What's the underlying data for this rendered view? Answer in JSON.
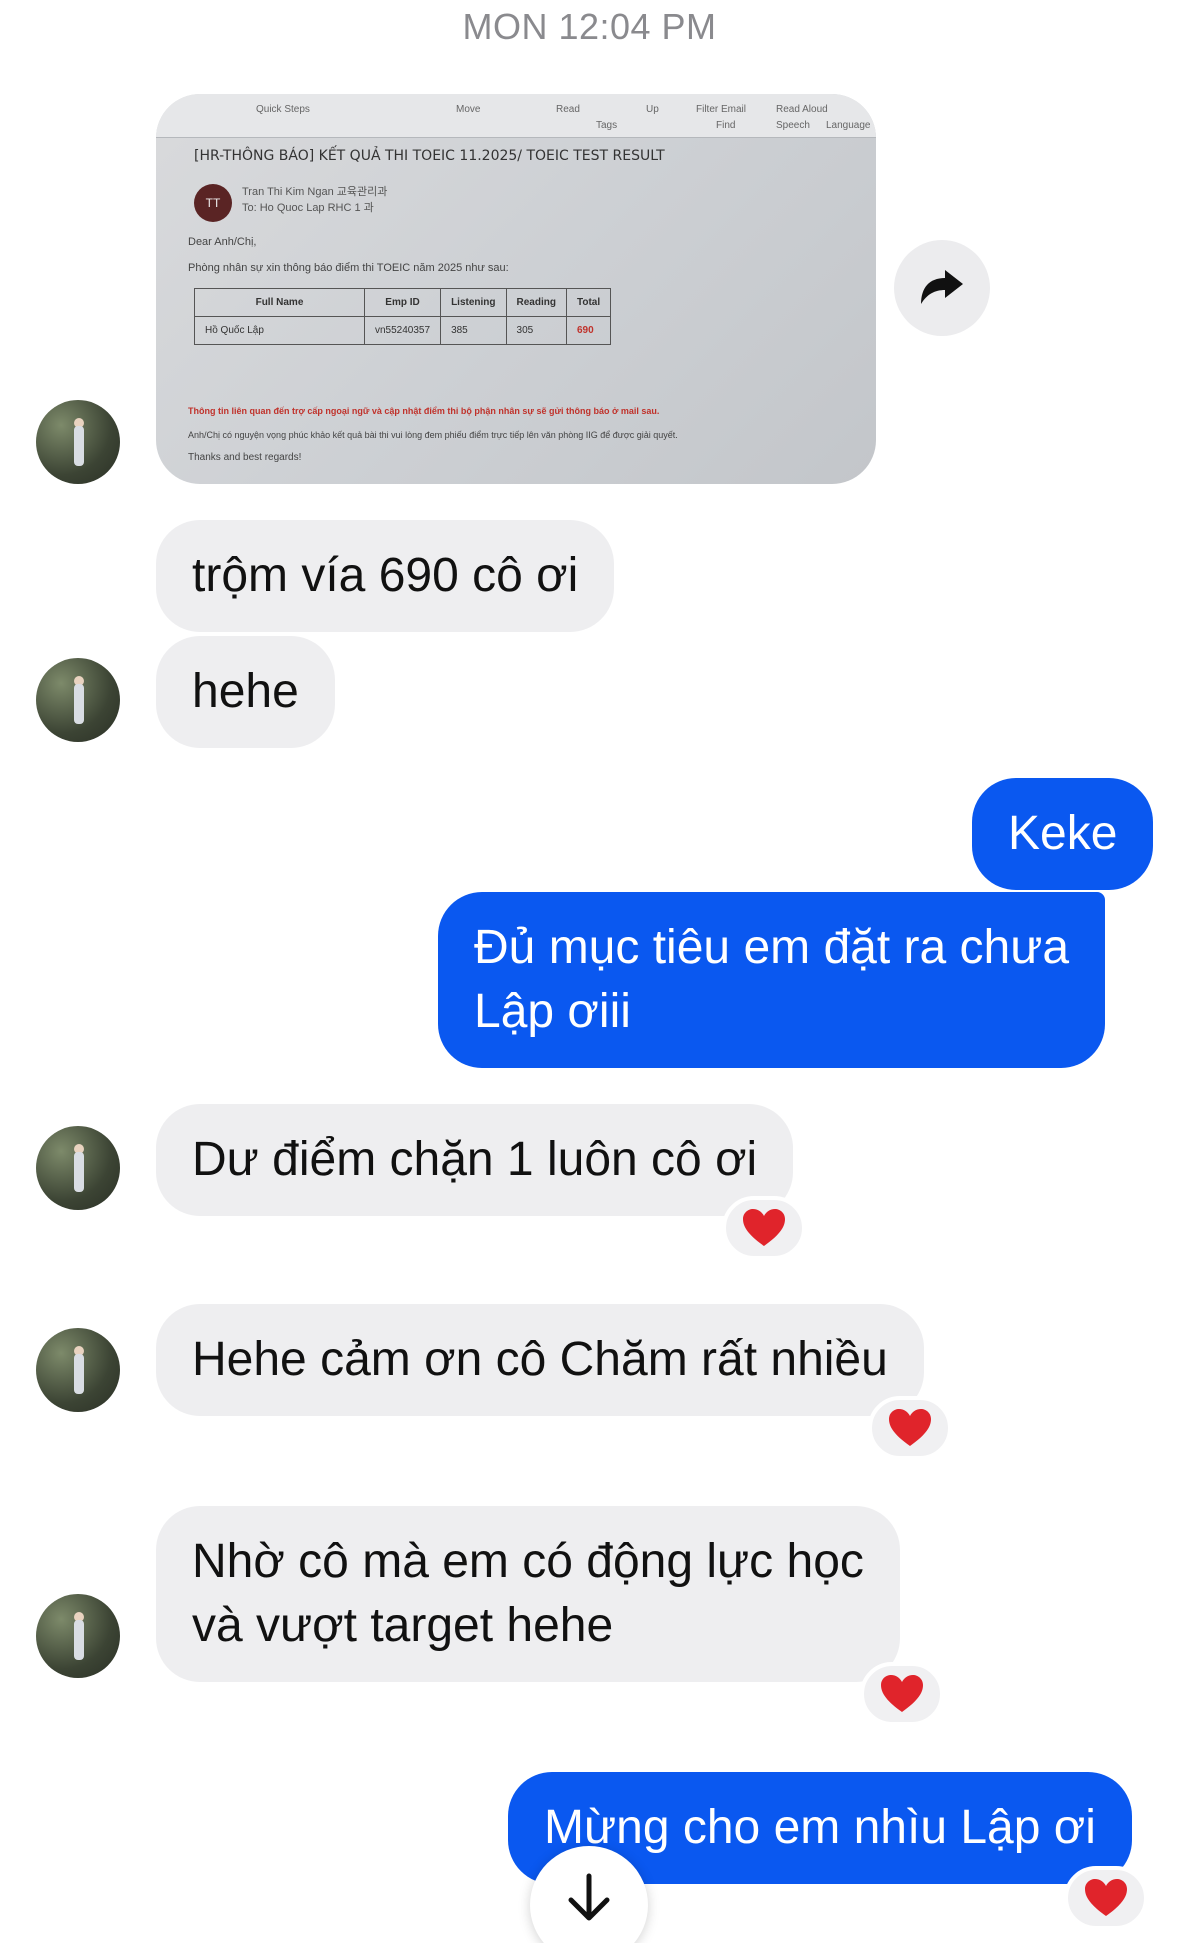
{
  "header": {
    "timestamp": "MON 12:04 PM"
  },
  "photo": {
    "ribbon": [
      "Quick Steps",
      "Move",
      "Read",
      "Tags",
      "Up",
      "Filter Email",
      "Find",
      "Read Aloud",
      "Speech",
      "Language"
    ],
    "subject": "[HR-THÔNG BÁO] KẾT QUẢ THI TOEIC 11.2025/ TOEIC TEST RESULT",
    "avatar_initials": "TT",
    "from": "Tran Thi Kim Ngan 교육관리과",
    "to": "To: Ho Quoc Lap RHC 1 과",
    "greeting": "Dear Anh/Chị,",
    "intro": "Phòng nhân sự xin thông báo điểm thi TOEIC năm 2025 như sau:",
    "table": {
      "headers": [
        "Full Name",
        "Emp ID",
        "Listening",
        "Reading",
        "Total"
      ],
      "row": [
        "Hồ Quốc Lập",
        "vn55240357",
        "385",
        "305",
        "690"
      ]
    },
    "note_red": "Thông tin liên quan đến trợ cấp ngoại ngữ và cập nhật điểm thi bộ phận nhân sự sẽ gửi thông báo ở mail sau.",
    "note": "Anh/Chị có nguyện vọng phúc khảo kết quả bài thi vui lòng đem phiếu điểm trực tiếp lên văn phòng IIG để được giải quyết.",
    "closing": "Thanks and best regards!"
  },
  "messages": [
    {
      "side": "in",
      "text": "trộm vía 690 cô ơi"
    },
    {
      "side": "in",
      "text": "hehe"
    },
    {
      "side": "out",
      "text": "Keke"
    },
    {
      "side": "out",
      "text": "Đủ mục tiêu em đặt ra chưa",
      "text2": "Lập ơiii"
    },
    {
      "side": "in",
      "text": "Dư điểm chặn 1 luôn cô ơi",
      "reaction": "heart"
    },
    {
      "side": "in",
      "text": "Hehe cảm ơn cô Chăm rất nhiều",
      "reaction": "heart"
    },
    {
      "side": "in",
      "text": "Nhờ cô mà em có động lực học",
      "text2": "và vượt target hehe",
      "reaction": "heart"
    },
    {
      "side": "out",
      "text": "Mừng cho em nhìu Lập ơi",
      "reaction": "heart"
    }
  ],
  "colors": {
    "outgoing": "#0a58f0",
    "incoming": "#eeeef0",
    "heart": "#e0242b"
  }
}
